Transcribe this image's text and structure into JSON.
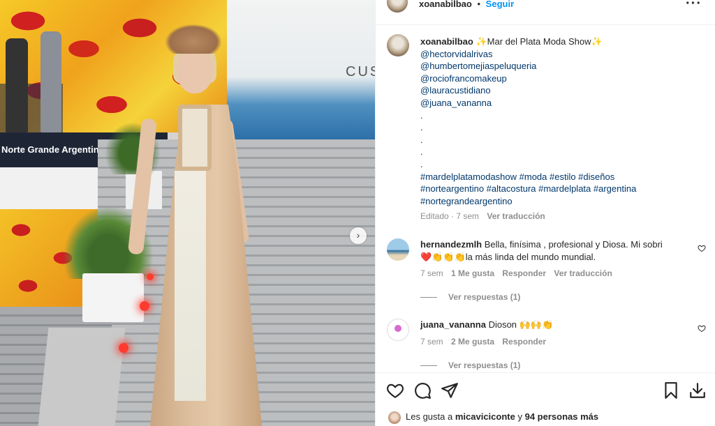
{
  "post": {
    "author": "xoanabilbao",
    "separator": "•",
    "follow_label": "Seguir",
    "more_label": "···",
    "photo_banner_text": "Norte Grande Argentino",
    "photo_sky_text": "CUS",
    "next_label": "›"
  },
  "caption": {
    "author": "xoanabilbao",
    "text": "✨Mar del Plata Moda Show✨",
    "mentions": [
      "@hectorvidalrivas",
      "@humbertomejiaspeluqueria",
      "@rociofrancomakeup",
      "@lauracustidiano",
      "@juana_vananna"
    ],
    "dots": [
      ".",
      ".",
      ".",
      ".",
      "."
    ],
    "hashtags_line1": "#mardelplatamodashow #moda #estilo #diseños",
    "hashtags_line2": "#norteargentino #altacostura #mardelplata #argentina",
    "hashtags_line3": "#nortegrandeargentino",
    "edited": "Editado · 7 sem",
    "see_translation": "Ver traducción"
  },
  "comments": [
    {
      "user": "hernandezmlh",
      "text_line1": "Bella, finísima , profesional y Diosa. Mi sobri",
      "text_line2": "❤️👏👏👏la más linda del mundo mundial.",
      "age": "7 sem",
      "likes": "1 Me gusta",
      "reply": "Responder",
      "translate": "Ver traducción",
      "view_replies": "Ver respuestas (1)"
    },
    {
      "user": "juana_vananna",
      "text_line1": "Dioson 🙌🙌👏",
      "age": "7 sem",
      "likes": "2 Me gusta",
      "reply": "Responder",
      "view_replies": "Ver respuestas (1)"
    }
  ],
  "likes_bar": {
    "prefix": "Les gusta a",
    "user": "micaviciconte",
    "connector": "y",
    "others": "94 personas más"
  },
  "icons": {
    "like": "heart-icon",
    "comment": "comment-icon",
    "share": "send-icon",
    "save": "bookmark-icon",
    "download": "download-icon"
  }
}
